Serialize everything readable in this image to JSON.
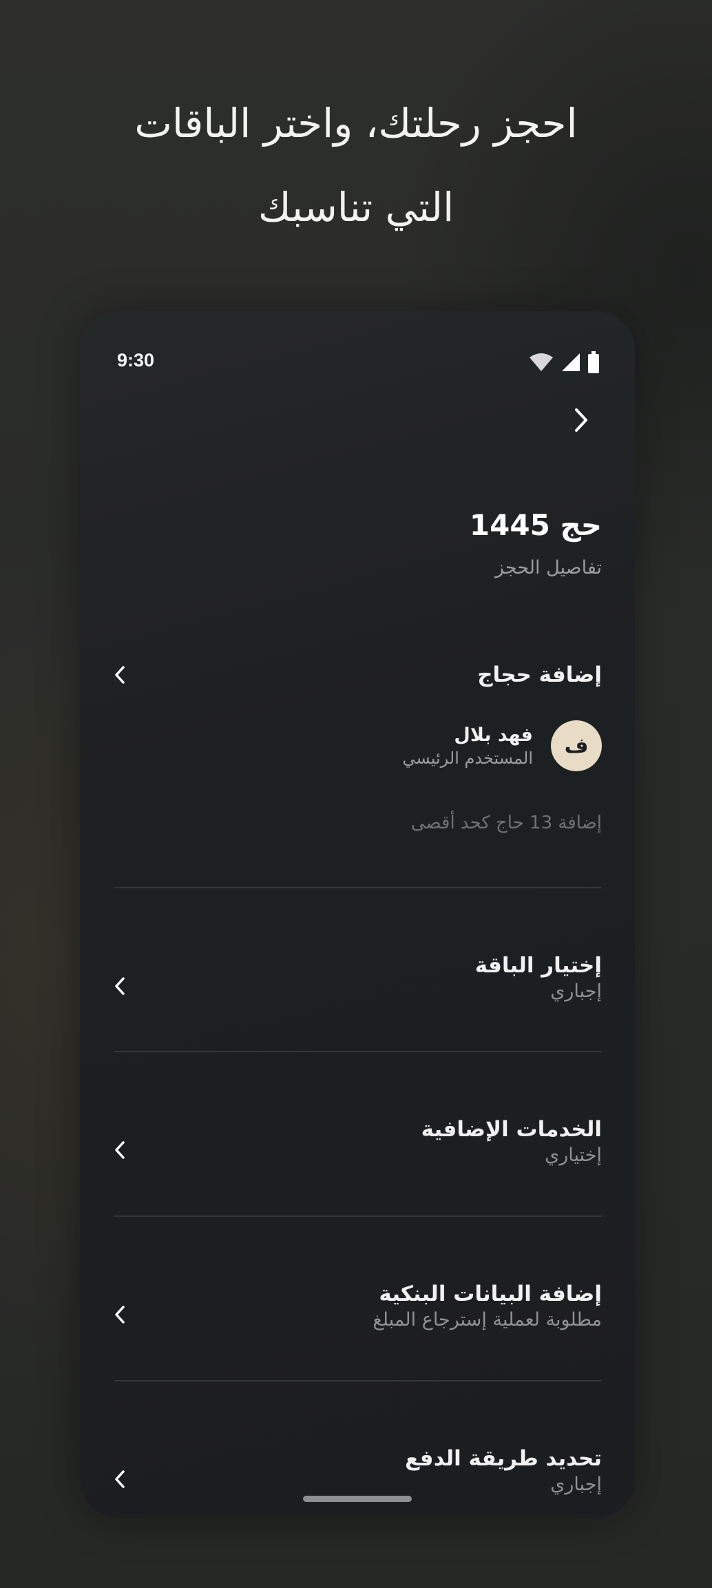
{
  "headline": {
    "line1": "احجز رحلتك، واختر الباقات",
    "line2": "التي تناسبك"
  },
  "status_bar": {
    "time": "9:30",
    "icons": [
      "wifi-icon",
      "signal-icon",
      "battery-icon"
    ]
  },
  "header": {
    "back_icon": "chevron-right-icon",
    "title": "حج 1445",
    "subtitle": "تفاصيل الحجز"
  },
  "pilgrims": {
    "label": "إضافة حجاج",
    "traveler": {
      "initial": "ف",
      "name": "فهد بلال",
      "role": "المستخدم الرئيسي"
    },
    "hint": "إضافة 13 حاج كحد أقصى"
  },
  "sections": [
    {
      "title": "إختيار الباقة",
      "subtitle": "إجباري"
    },
    {
      "title": "الخدمات الإضافية",
      "subtitle": "إختياري"
    },
    {
      "title": "إضافة البيانات البنكية",
      "subtitle": "مطلوبة لعملية إسترجاع المبلغ"
    },
    {
      "title": "تحديد طريقة الدفع",
      "subtitle": "إجباري"
    }
  ],
  "colors": {
    "accent_avatar": "#e9dcc7",
    "background": "#1d2022"
  }
}
